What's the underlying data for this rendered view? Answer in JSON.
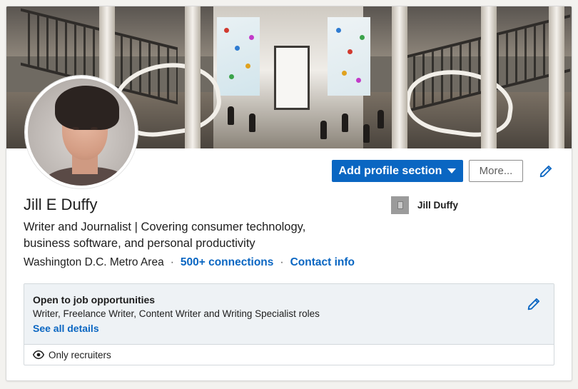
{
  "profile": {
    "name": "Jill E Duffy",
    "headline": "Writer and Journalist | Covering consumer technology, business software, and personal productivity",
    "location": "Washington D.C. Metro Area",
    "connections": "500+ connections",
    "contact_info": "Contact info",
    "separator": "·"
  },
  "actions": {
    "add_profile_section": "Add profile section",
    "more": "More..."
  },
  "company": {
    "name": "Jill Duffy",
    "logo_icon": "building-icon"
  },
  "job_opportunities": {
    "title": "Open to job opportunities",
    "roles": "Writer, Freelance Writer, Content Writer and Writing Specialist roles",
    "see_all": "See all details",
    "visibility": "Only recruiters"
  },
  "icons": {
    "edit": "pencil-icon",
    "caret": "caret-down-icon",
    "visibility": "eye-icon"
  },
  "colors": {
    "brand_blue": "#0a66c2",
    "box_bg": "#eef2f5",
    "page_bg": "#f3f2ef"
  }
}
